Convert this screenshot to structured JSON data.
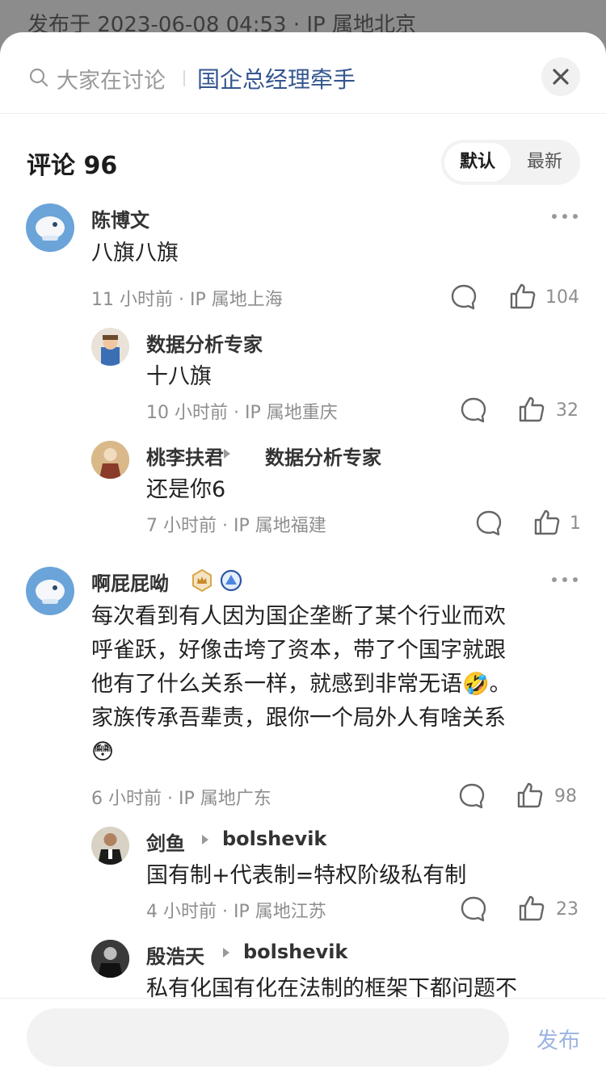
{
  "background": {
    "post_meta": "发布于 2023-06-08 04:53 · IP 属地北京"
  },
  "header": {
    "search_label": "大家在讨论",
    "topic": "国企总经理牵手"
  },
  "comments_header": {
    "title": "评论 96",
    "sort_default": "默认",
    "sort_newest": "最新"
  },
  "comments": [
    {
      "name": "陈博文",
      "text": "八旗八旗",
      "meta": "11 小时前 · IP 属地上海",
      "likes": "104",
      "replies": [
        {
          "name": "数据分析专家",
          "text": "十八旗",
          "meta": "10 小时前 · IP 属地重庆",
          "likes": "32"
        },
        {
          "name": "桃李扶君",
          "reply_to": "数据分析专家",
          "text": "还是你6",
          "meta": "7 小时前 · IP 属地福建",
          "likes": "1"
        }
      ]
    },
    {
      "name": "啊屁屁呦",
      "text_lines": [
        "每次看到有人因为国企垄断了某个行业而欢",
        "呼雀跃，好像击垮了资本，带了个国字就跟",
        "他有了什么关系一样，就感到非常无语🤣。",
        "家族传承吾辈责，跟你一个局外人有啥关系",
        "😳"
      ],
      "meta": "6 小时前 · IP 属地广东",
      "likes": "98",
      "replies": [
        {
          "name": "剑鱼",
          "reply_to": "bolshevik",
          "text": "国有制+代表制=特权阶级私有制",
          "meta": "4 小时前 · IP 属地江苏",
          "likes": "23"
        },
        {
          "name": "殷浩天",
          "reply_to": "bolshevik",
          "text": "私有化国有化在法制的框架下都问题不"
        }
      ]
    }
  ],
  "footer": {
    "input_placeholder": "",
    "publish": "发布"
  },
  "colors": {
    "accent_link": "#34568f",
    "publish_disabled": "#9db5e0",
    "meta_gray": "#8e8e8e"
  }
}
